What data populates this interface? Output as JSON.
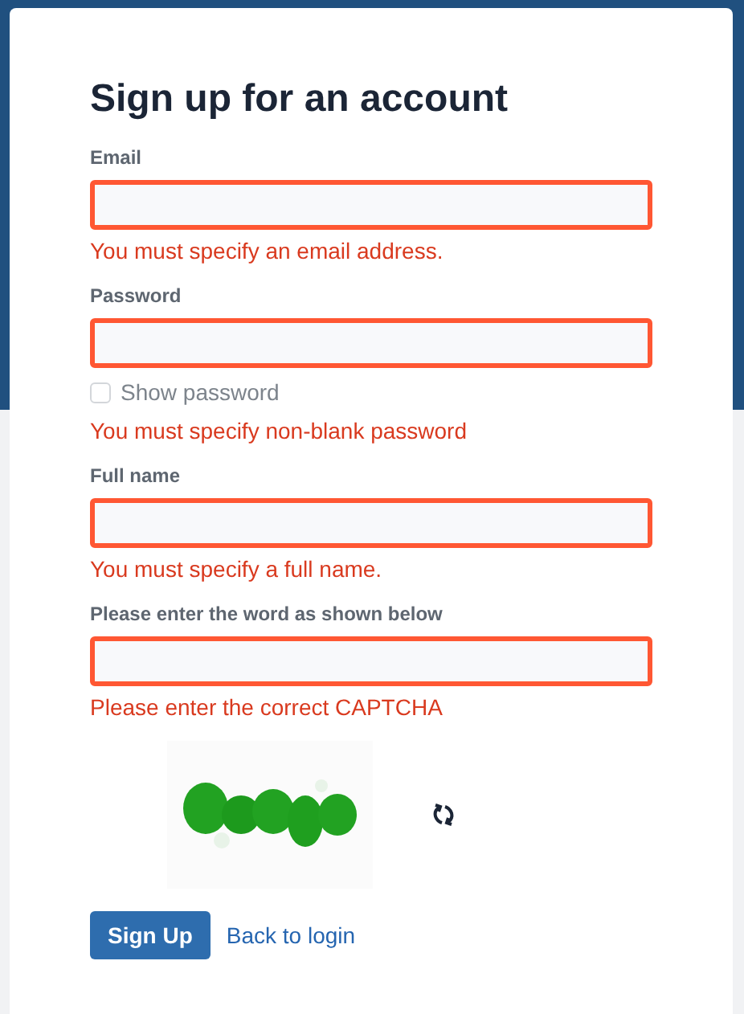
{
  "title": "Sign up for an account",
  "fields": [
    {
      "label": "Email",
      "invalid": true,
      "error": "You must specify an email address."
    },
    {
      "label": "Password",
      "invalid": true,
      "show_password": {
        "label": "Show password",
        "checked": false
      },
      "error": "You must specify non-blank password"
    },
    {
      "label": "Full name",
      "invalid": true,
      "error": "You must specify a full name."
    },
    {
      "label": "Please enter the word as shown below",
      "invalid": true,
      "error": "Please enter the correct CAPTCHA"
    }
  ],
  "submit": "Sign Up",
  "back_link": "Back to login"
}
